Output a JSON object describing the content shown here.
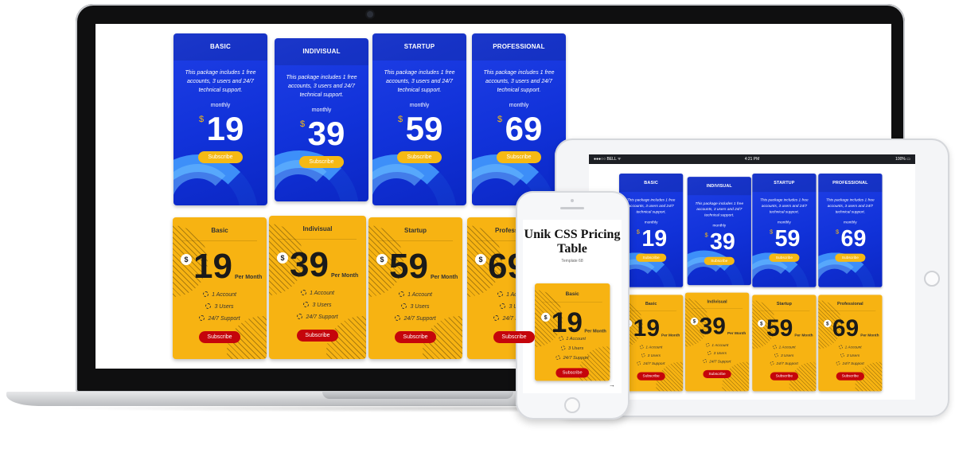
{
  "plans": [
    {
      "tier_upper": "BASIC",
      "tier": "Basic",
      "price": "19"
    },
    {
      "tier_upper": "INDIVISUAL",
      "tier": "Indivisual",
      "price": "39"
    },
    {
      "tier_upper": "STARTUP",
      "tier": "Startup",
      "price": "59"
    },
    {
      "tier_upper": "PROFESSIONAL",
      "tier": "Professional",
      "price": "69"
    }
  ],
  "blue": {
    "description": "This package includes 1 free accounts, 3 users and 24/7 technical support.",
    "period": "monthly",
    "currency": "$",
    "subscribe": "Subscribe"
  },
  "yellow": {
    "currency": "$",
    "per_month": "Per Month",
    "features": [
      "1 Account",
      "3 Users",
      "24/7 Support"
    ],
    "subscribe": "Subscribe"
  },
  "tablet_status": {
    "carrier": "●●●○○ BELL ᯤ",
    "time": "4:21 PM",
    "battery": "100% ▭"
  },
  "phone": {
    "title": "Unik CSS Pricing Table",
    "subtitle": "Template 68",
    "next": "→"
  },
  "colors": {
    "blue": "#1132d9",
    "yellow": "#f7b312",
    "red": "#c5050b",
    "accent": "#f5b914"
  }
}
